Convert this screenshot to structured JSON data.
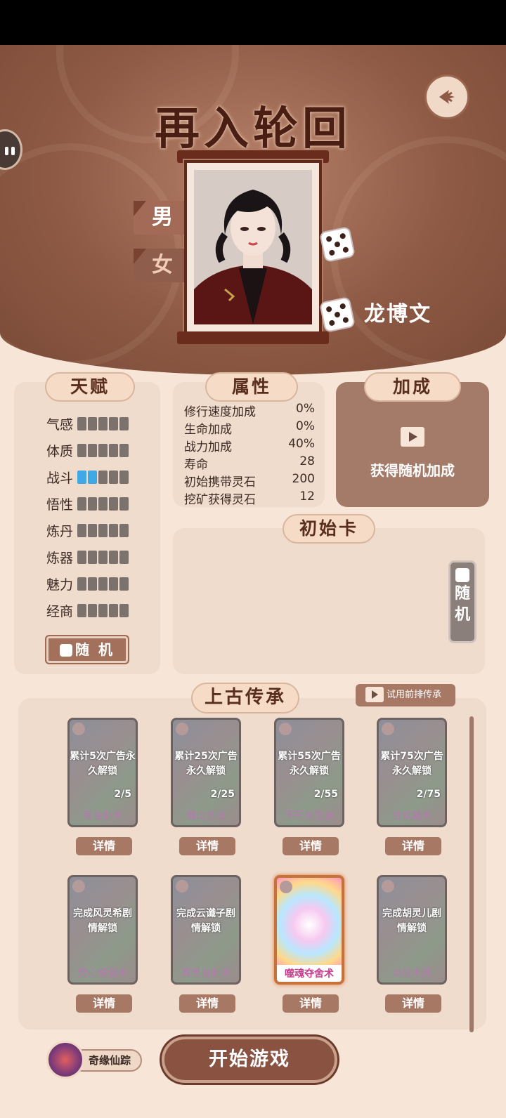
{
  "header": {
    "title": "再入轮回",
    "gender_male": "男",
    "gender_female": "女",
    "character_name": "龙博文"
  },
  "talent": {
    "title": "天赋",
    "items": [
      {
        "label": "气感",
        "level": 0
      },
      {
        "label": "体质",
        "level": 0
      },
      {
        "label": "战斗",
        "level": 2
      },
      {
        "label": "悟性",
        "level": 0
      },
      {
        "label": "炼丹",
        "level": 0
      },
      {
        "label": "炼器",
        "level": 0
      },
      {
        "label": "魅力",
        "level": 0
      },
      {
        "label": "经商",
        "level": 0
      }
    ],
    "max_level": 5,
    "random_label": "随 机"
  },
  "attributes": {
    "title": "属性",
    "items": [
      {
        "label": "修行速度加成",
        "value": "0%"
      },
      {
        "label": "生命加成",
        "value": "0%"
      },
      {
        "label": "战力加成",
        "value": "40%"
      },
      {
        "label": "寿命",
        "value": "28"
      },
      {
        "label": "初始携带灵石",
        "value": "200"
      },
      {
        "label": "挖矿获得灵石",
        "value": "12"
      }
    ]
  },
  "bonus": {
    "title": "加成",
    "action_label": "获得随机加成"
  },
  "initial_card": {
    "title": "初始卡",
    "random_label": "随机"
  },
  "legacy": {
    "title": "上古传承",
    "trial_label": "试用前排传承",
    "detail_label": "详情",
    "skills": [
      {
        "lock": "累计5次广告永久解锁",
        "progress": "2/5",
        "name": "鬼谷卦术"
      },
      {
        "lock": "累计25次广告永久解锁",
        "progress": "2/25",
        "name": "蜀山剑法"
      },
      {
        "lock": "累计55次广告永久解锁",
        "progress": "2/55",
        "name": "不死长生诀"
      },
      {
        "lock": "累计75次广告永久解锁",
        "progress": "2/75",
        "name": "合欢魅术"
      },
      {
        "lock": "完成风灵希剧情解锁",
        "progress": "",
        "name": "焚心锻造术"
      },
      {
        "lock": "完成云谶子剧情解锁",
        "progress": "",
        "name": "真鬼谷卦术"
      },
      {
        "lock": "",
        "progress": "",
        "name": "噬魂夺舍术"
      },
      {
        "lock": "完成胡灵儿剧情解锁",
        "progress": "",
        "name": "龙纹木戒"
      }
    ]
  },
  "footer": {
    "fortune_label": "奇缘仙踪",
    "start_label": "开始游戏"
  },
  "colors": {
    "header_brown": "#8e5a45",
    "panel_bg": "#f0dccd",
    "talent_active": "#3fa9e5",
    "button_brown": "#a77864"
  }
}
